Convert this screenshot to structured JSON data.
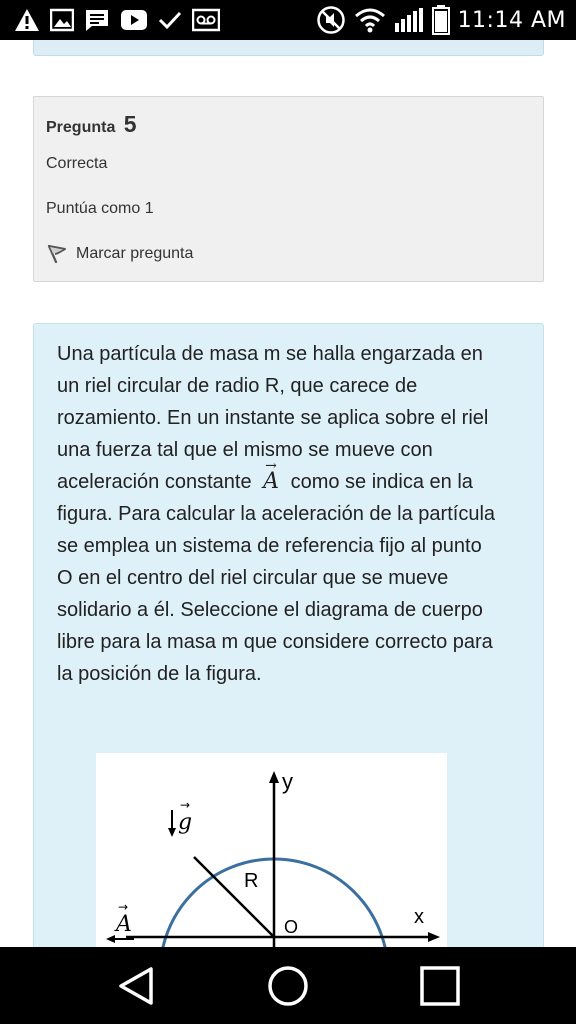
{
  "status_bar": {
    "time": "11:14 AM",
    "left_icons": [
      "alert-icon",
      "image-icon",
      "message-icon",
      "play-icon",
      "check-icon",
      "voicemail-icon"
    ],
    "right_icons": [
      "mute-icon",
      "wifi-icon",
      "signal-icon",
      "battery-icon"
    ]
  },
  "question_info": {
    "title_prefix": "Pregunta",
    "number": "5",
    "status": "Correcta",
    "score": "Puntúa como 1",
    "flag_label": "Marcar pregunta"
  },
  "question": {
    "text_part1": "Una partícula de masa m se halla engarzada en un riel circular de radio R, que carece de rozamiento. En un instante se aplica sobre el riel una fuerza tal que el mismo se mueve con aceleración constante",
    "vector_symbol": "A",
    "text_part2": "como se indica en la figura. Para calcular la aceleración de la partícula se emplea un sistema de referencia fijo al punto O en el centro del riel circular que se mueve solidario a él. Seleccione el diagrama de cuerpo libre para la masa m que considere correcto para la posición de la figura."
  },
  "figure": {
    "y_label": "y",
    "x_label": "x",
    "origin_label": "O",
    "radius_label": "R",
    "g_label": "g",
    "a_label": "A",
    "circle_color": "#3b6fa0"
  },
  "nav_bar": {
    "buttons": [
      "back-icon",
      "home-icon",
      "recents-icon"
    ]
  }
}
